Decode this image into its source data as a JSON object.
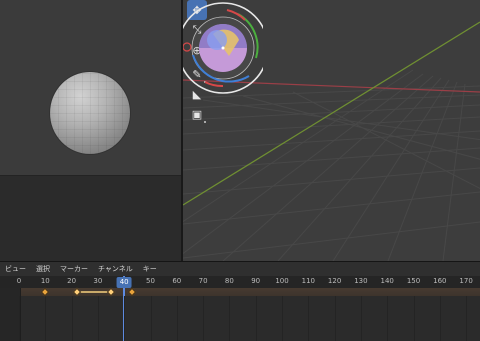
{
  "timeline": {
    "menus": [
      "ビュー",
      "選択",
      "マーカー",
      "チャンネル",
      "キー"
    ],
    "ticks": [
      {
        "label": "0",
        "frame": 0
      },
      {
        "label": "10",
        "frame": 10
      },
      {
        "label": "20",
        "frame": 20
      },
      {
        "label": "30",
        "frame": 30
      },
      {
        "label": "50",
        "frame": 50
      },
      {
        "label": "60",
        "frame": 60
      },
      {
        "label": "70",
        "frame": 70
      },
      {
        "label": "80",
        "frame": 80
      },
      {
        "label": "90",
        "frame": 90
      },
      {
        "label": "100",
        "frame": 100
      },
      {
        "label": "110",
        "frame": 110
      },
      {
        "label": "120",
        "frame": 120
      },
      {
        "label": "130",
        "frame": 130
      },
      {
        "label": "140",
        "frame": 140
      },
      {
        "label": "150",
        "frame": 150
      },
      {
        "label": "160",
        "frame": 160
      },
      {
        "label": "170",
        "frame": 170
      }
    ],
    "current_frame": "40",
    "keyframes": [
      10,
      22,
      35,
      43
    ]
  },
  "colors": {
    "accent": "#4772b3",
    "x_axis": "#b0404a",
    "y_axis": "#7fa33a",
    "keyframe": "#e8a33c"
  },
  "tools": [
    "transform-tool-icon",
    "scale-tool-icon",
    "transform-pivot-icon",
    "annotate-tool-icon",
    "measure-tool-icon",
    "add-cube-tool-icon"
  ]
}
